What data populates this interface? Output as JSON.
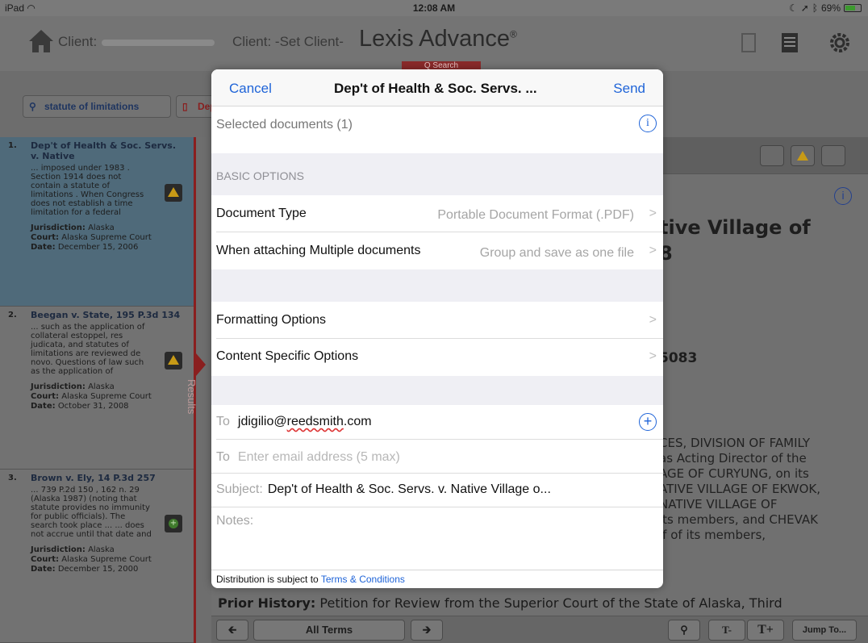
{
  "status_bar": {
    "device": "iPad",
    "time": "12:08 AM",
    "battery": "69%",
    "battery_level": 0.69
  },
  "header": {
    "client_label": "Client:",
    "set_client": "Client: -Set Client-",
    "brand": "Lexis Advance",
    "brand_mark": "®",
    "search_tab": "Q Search"
  },
  "search_row": {
    "query": "statute of limitations",
    "doc_chip": "Dep"
  },
  "results": [
    {
      "num": "1.",
      "title": "Dep't of Health & Soc. Servs. v. Native",
      "snippet": "... imposed under 1983 . Section 1914 does not contain a statute of limitations . When Congress does not establish a time limitation for a federal",
      "jurisdiction_label": "Jurisdiction:",
      "jurisdiction": "Alaska",
      "court_label": "Court:",
      "court": "Alaska Supreme Court",
      "date_label": "Date:",
      "date": "December 15, 2006"
    },
    {
      "num": "2.",
      "title": "Beegan v. State, 195 P.3d 134",
      "snippet": "... such as the application of collateral estoppel, res judicata, and statutes of limitations are reviewed de novo. Questions of law such as the application of",
      "jurisdiction_label": "Jurisdiction:",
      "jurisdiction": "Alaska",
      "court_label": "Court:",
      "court": "Alaska Supreme Court",
      "date_label": "Date:",
      "date": "October 31, 2008"
    },
    {
      "num": "3.",
      "title": "Brown v. Ely, 14 P.3d 257",
      "snippet": "... 739 P.2d 150 , 162 n. 29 (Alaska 1987) (noting that statute provides no immunity for public officials). The search took place ... ... does not accrue until that date and",
      "jurisdiction_label": "Jurisdiction:",
      "jurisdiction": "Alaska",
      "court_label": "Court:",
      "court": "Alaska Supreme Court",
      "date_label": "Date:",
      "date": "December 15, 2000"
    }
  ],
  "results_tab": "Results",
  "document": {
    "title_line1": "tive Village of",
    "title_line2": "8",
    "cite_fragment": "5083",
    "parties_lines": [
      "CES, DIVISION OF FAMILY",
      "as Acting Director of the",
      "AGE OF CURYUNG, on its",
      "ATIVE VILLAGE OF EKWOK,",
      "NATIVE VILLAGE OF",
      "its members, and CHEVAK",
      "lf of its members,"
    ],
    "prior_history_label": "Prior History:",
    "prior_history_text": "Petition for Review from the Superior Court of the State of Alaska, Third"
  },
  "bottom_bar": {
    "all_terms": "All Terms",
    "t_minus": "T-",
    "t_plus": "T+",
    "jump_to": "Jump To..."
  },
  "modal": {
    "cancel": "Cancel",
    "title": "Dep't of Health & Soc. Servs. ...",
    "send": "Send",
    "selected_documents": "Selected documents (1)",
    "basic_options": "BASIC OPTIONS",
    "document_type_label": "Document Type",
    "document_type_value": "Portable Document Format (.PDF)",
    "multiple_label": "When attaching Multiple documents",
    "multiple_value": "Group and save as one file",
    "formatting_options": "Formatting Options",
    "content_specific_options": "Content Specific Options",
    "to_label": "To",
    "to_value_name": "jdigilio@",
    "to_value_domain": "reedsmith",
    "to_value_tld": ".com",
    "to2_placeholder": "Enter email address (5 max)",
    "subject_label": "Subject:",
    "subject_value": "Dep't of Health & Soc. Servs. v. Native Village o...",
    "notes_label": "Notes:",
    "distribution_text": "Distribution is subject to",
    "terms_link": "Terms & Conditions"
  }
}
